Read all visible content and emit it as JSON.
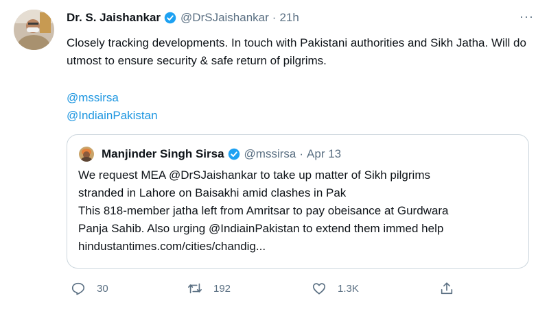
{
  "author": {
    "name": "Dr. S. Jaishankar",
    "handle": "@DrSJaishankar",
    "separator": "·",
    "time": "21h"
  },
  "more_label": "···",
  "tweet": {
    "text": "Closely tracking developments. In touch with Pakistani authorities and Sikh Jatha. Will do utmost to ensure security & safe return of pilgrims.",
    "mentions": [
      "@mssirsa",
      "@IndiainPakistan"
    ]
  },
  "quoted": {
    "name": "Manjinder Singh Sirsa",
    "handle": "@mssirsa",
    "separator": "·",
    "time": "Apr 13",
    "lines": [
      "We request MEA @DrSJaishankar to take up matter of Sikh pilgrims",
      "stranded in Lahore on Baisakhi amid clashes in Pak",
      "This 818-member jatha left from Amritsar to pay obeisance at Gurdwara",
      "Panja Sahib. Also urging @IndiainPakistan to extend them immed help",
      "hindustantimes.com/cities/chandig..."
    ]
  },
  "actions": {
    "reply_count": "30",
    "retweet_count": "192",
    "like_count": "1.3K"
  },
  "colors": {
    "link": "#1b95e0",
    "secondary_text": "#5b7083",
    "verified": "#1da1f2",
    "border": "#ccd6dd"
  }
}
